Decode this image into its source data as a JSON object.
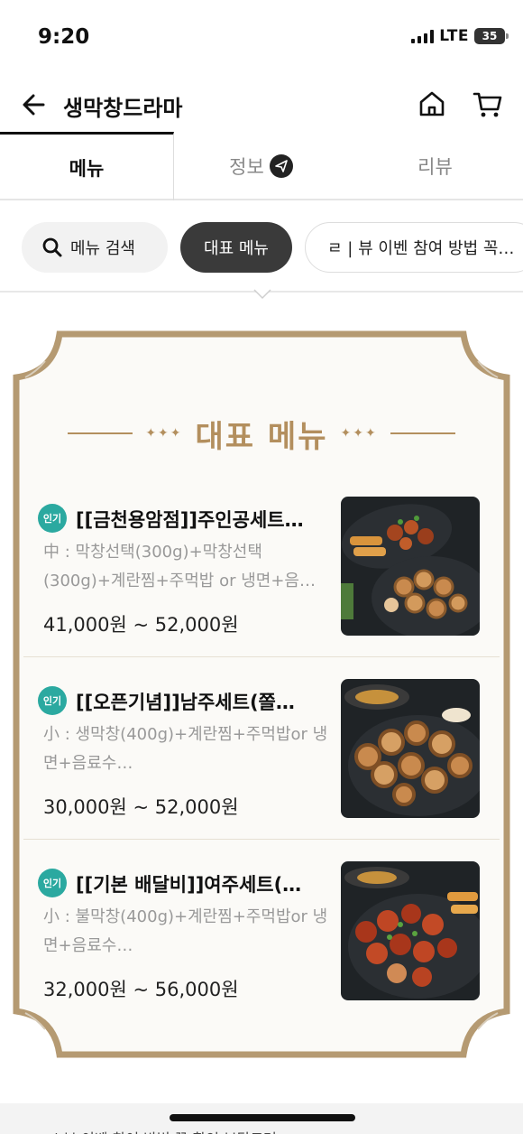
{
  "status_bar": {
    "time": "9:20",
    "network": "LTE",
    "battery": "35"
  },
  "header": {
    "title": "생막창드라마"
  },
  "tabs": [
    {
      "label": "메뉴"
    },
    {
      "label": "정보"
    },
    {
      "label": "리뷰"
    }
  ],
  "chips": {
    "search": "메뉴 검색",
    "representative": "대표 메뉴",
    "event": "ㄹ | 뷰 이벤 참여 방법 꼭…"
  },
  "section": {
    "title": "대표 메뉴"
  },
  "menu_items": [
    {
      "badge": "인기",
      "name": "[[금천용암점]]주인공세트…",
      "description": "中 : 막창선택(300g)+막창선택(300g)+계란찜+주먹밥 or 냉면+음…",
      "price": "41,000원 ~ 52,000원"
    },
    {
      "badge": "인기",
      "name": "[[오픈기념]]남주세트(쫄…",
      "description": "小 : 생막창(400g)+계란찜+주먹밥or 냉면+음료수…",
      "price": "30,000원 ~ 52,000원"
    },
    {
      "badge": "인기",
      "name": "[[기본 배달비]]여주세트(…",
      "description": "小 : 불막창(400g)+계란찜+주먹밥or 냉면+음료수…",
      "price": "32,000원 ~ 56,000원"
    }
  ],
  "bottom_peek": "ㄹ | 뷰 이벤 참여 방법 꼭 확인 부탁드려"
}
